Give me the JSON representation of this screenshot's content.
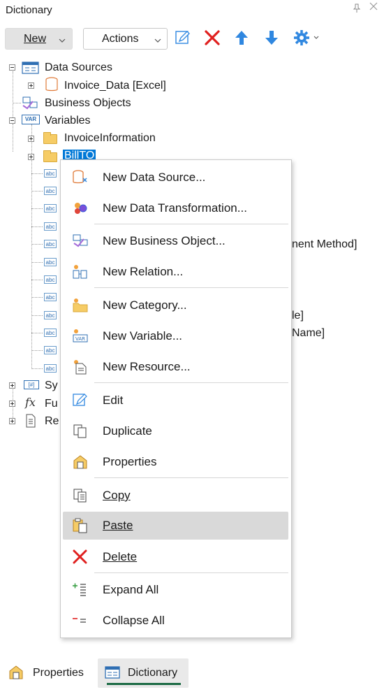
{
  "window": {
    "title": "Dictionary",
    "pin_glyph": "↕",
    "close_glyph": "✕"
  },
  "toolbar": {
    "new_label": "New",
    "actions_label": "Actions",
    "icons": [
      "edit-icon",
      "delete-icon",
      "move-up-icon",
      "move-down-icon",
      "settings-icon"
    ],
    "colors": {
      "delete": "#e0201f",
      "arrow": "#2f87e0",
      "gear": "#2f87e0"
    }
  },
  "tree": {
    "data_sources": "Data Sources",
    "invoice_data": "Invoice_Data [Excel]",
    "business_objects": "Business Objects",
    "variables": "Variables",
    "invoice_information": "InvoiceInformation",
    "bill_to": "BillTO",
    "partial_1": "nent Method]",
    "partial_2": "le]",
    "partial_3": "Name]",
    "sys_partial": "Sy",
    "fu_partial": "Fu",
    "re_partial": "Re"
  },
  "context_menu": {
    "items": [
      {
        "label": "New Data Source..."
      },
      {
        "label": "New Data Transformation..."
      },
      {
        "label": "New Business Object..."
      },
      {
        "label": "New Relation..."
      },
      {
        "label": "New Category..."
      },
      {
        "label": "New Variable..."
      },
      {
        "label": "New Resource..."
      },
      {
        "label": "Edit"
      },
      {
        "label": "Duplicate"
      },
      {
        "label": "Properties"
      },
      {
        "label": "Copy"
      },
      {
        "label": "Paste"
      },
      {
        "label": "Delete"
      },
      {
        "label": "Expand All"
      },
      {
        "label": "Collapse All"
      }
    ]
  },
  "bottom_tabs": {
    "properties": "Properties",
    "dictionary": "Dictionary"
  }
}
